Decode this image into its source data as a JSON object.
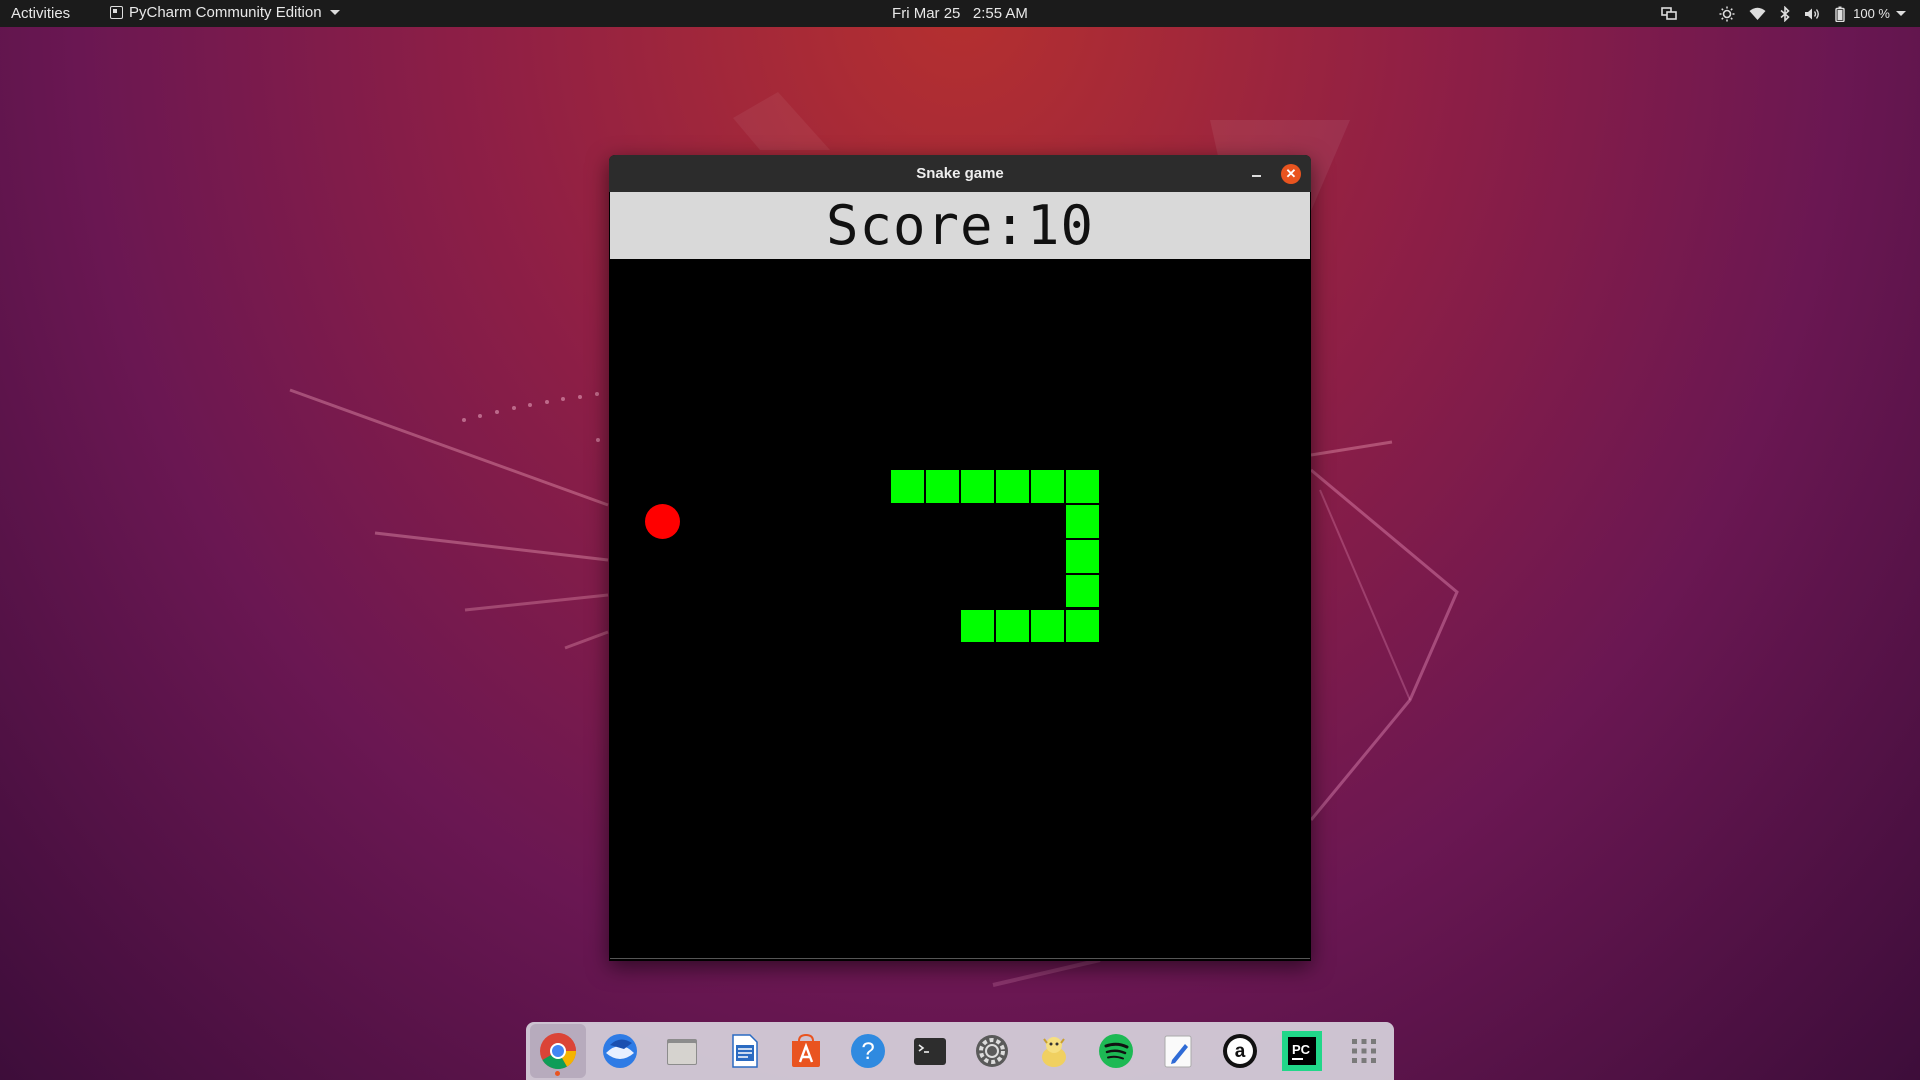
{
  "topbar": {
    "activities_label": "Activities",
    "app_menu_label": "PyCharm Community Edition",
    "clock": "Fri Mar 25   2:55 AM",
    "battery_percent": "100 %",
    "icons": [
      "screen-share-icon",
      "brightness-icon",
      "wifi-icon",
      "bluetooth-icon",
      "volume-icon",
      "battery-icon",
      "power-menu-caret-icon"
    ]
  },
  "window": {
    "title": "Snake game",
    "score_text": "Score:10",
    "close_glyph": "✕"
  },
  "game": {
    "grid_columns": 20,
    "grid_rows": 20,
    "snake_color": "#00ff00",
    "food_color": "#ff0000",
    "background_color": "#000000",
    "snake_cells": [
      [
        8,
        6
      ],
      [
        9,
        6
      ],
      [
        10,
        6
      ],
      [
        11,
        6
      ],
      [
        12,
        6
      ],
      [
        13,
        6
      ],
      [
        13,
        7
      ],
      [
        13,
        8
      ],
      [
        13,
        9
      ],
      [
        13,
        10
      ],
      [
        12,
        10
      ],
      [
        11,
        10
      ],
      [
        10,
        10
      ]
    ],
    "food_cell": [
      1,
      7
    ]
  },
  "dock": {
    "items": [
      {
        "name": "chrome-icon",
        "active": true
      },
      {
        "name": "thunderbird-icon",
        "active": false
      },
      {
        "name": "files-icon",
        "active": false
      },
      {
        "name": "writer-icon",
        "active": false
      },
      {
        "name": "software-icon",
        "active": false
      },
      {
        "name": "help-icon",
        "active": false
      },
      {
        "name": "terminal-icon",
        "active": false
      },
      {
        "name": "settings-icon",
        "active": false
      },
      {
        "name": "pet-icon",
        "active": false
      },
      {
        "name": "spotify-icon",
        "active": false
      },
      {
        "name": "text-editor-icon",
        "active": false
      },
      {
        "name": "amazon-icon",
        "active": false
      },
      {
        "name": "pycharm-icon",
        "active": false
      },
      {
        "name": "show-apps-icon",
        "active": false
      }
    ]
  }
}
